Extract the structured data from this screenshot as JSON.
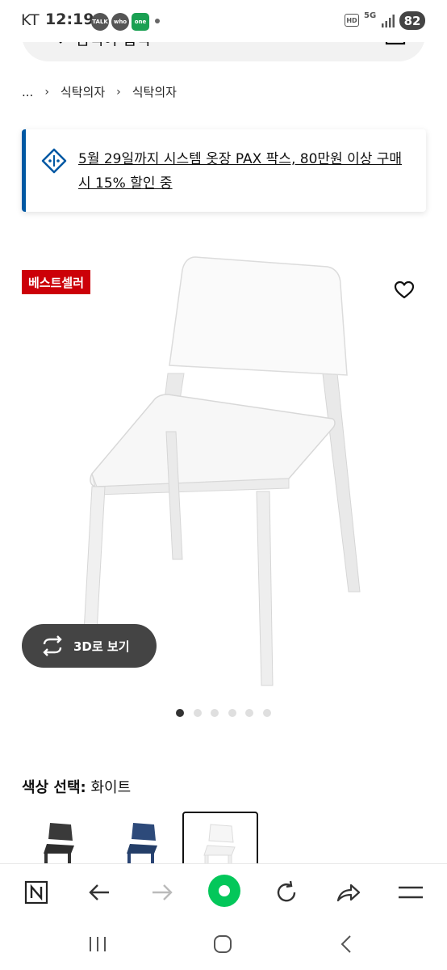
{
  "status_bar": {
    "carrier": "KT",
    "time": "12:19",
    "apps": [
      "TALK",
      "who",
      "one"
    ],
    "hd": "HD",
    "network": "5G",
    "battery": "82"
  },
  "search": {
    "text": "검색어 입력"
  },
  "breadcrumb": {
    "ellipsis": "...",
    "items": [
      "식탁의자",
      "식탁의자"
    ]
  },
  "promo": {
    "text": "5월 29일까지 시스템 옷장 PAX 팍스, 80만원 이상 구매시 15% 할인 중",
    "accent": "#0058a3"
  },
  "product": {
    "badge": "베스트셀러",
    "badge_color": "#cc0008",
    "view3d_label": "3D로 보기",
    "image_count": 6,
    "active_image": 1
  },
  "color_select": {
    "label": "색상 선택:",
    "value": "화이트",
    "swatches": [
      {
        "name": "black",
        "color": "#3a3a3a"
      },
      {
        "name": "blue",
        "color": "#2d4a7a"
      },
      {
        "name": "white",
        "color": "#f4f4f4",
        "selected": true
      }
    ]
  },
  "browser_bar": {
    "icons": [
      "naver-n-icon",
      "back-icon",
      "forward-icon",
      "home-green-icon",
      "refresh-icon",
      "share-icon",
      "menu-icon"
    ],
    "brand_green": "#03c75a"
  },
  "android_nav": {
    "icons": [
      "recents-icon",
      "home-icon",
      "back-icon"
    ]
  }
}
